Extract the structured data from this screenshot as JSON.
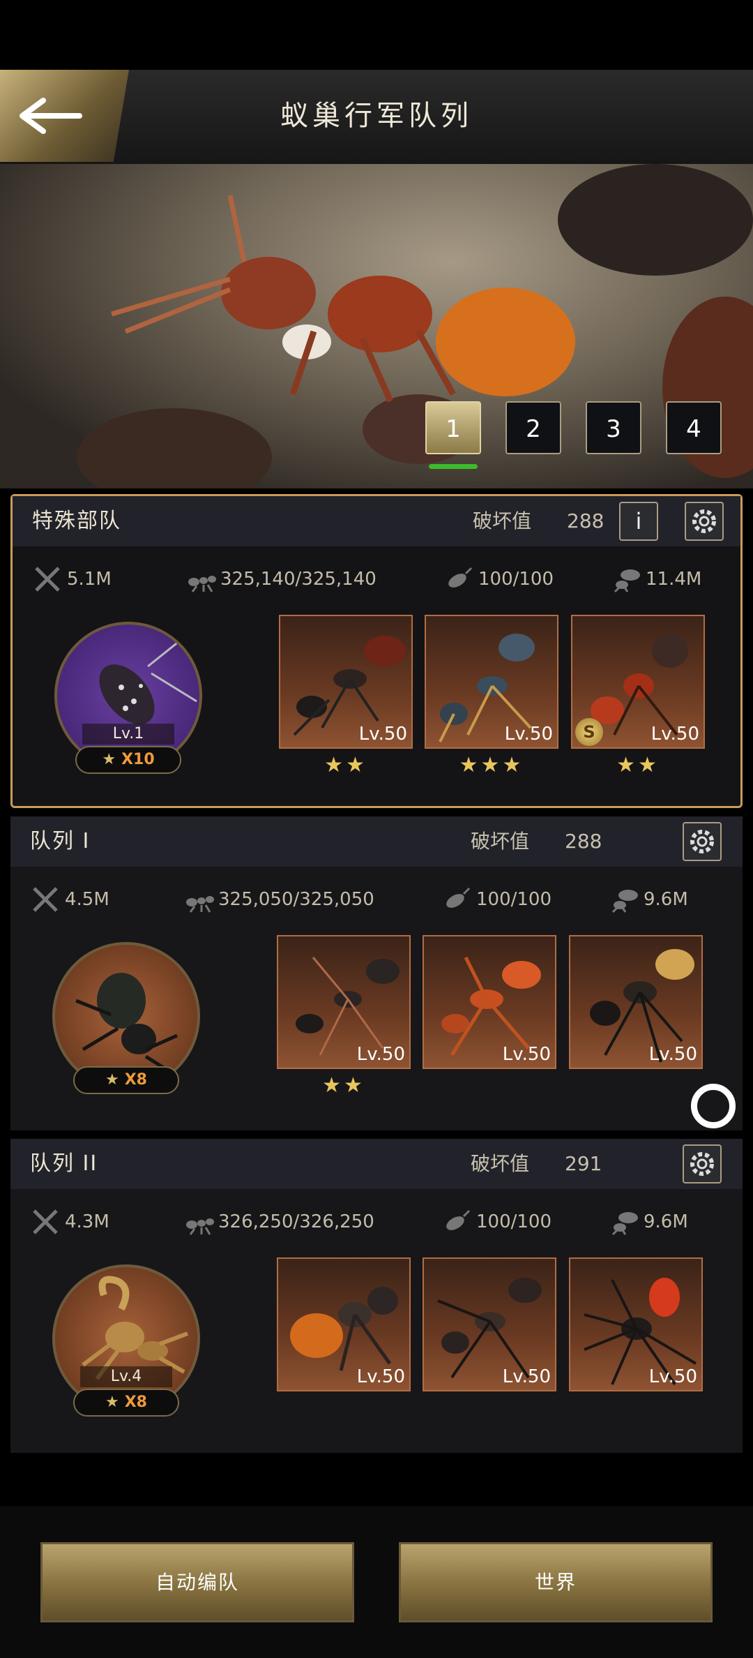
{
  "header": {
    "title": "蚁巢行军队列"
  },
  "page_tabs": [
    "1",
    "2",
    "3",
    "4"
  ],
  "squads": [
    {
      "name": "特殊部队",
      "power_label": "破坏值",
      "power": "288",
      "stats": {
        "attack": "5.1M",
        "troops": "325,140/325,140",
        "morale": "100/100",
        "load": "11.4M"
      },
      "hero": {
        "level": "Lv.1",
        "stars": "X10"
      },
      "units": [
        {
          "level": "Lv.50",
          "stars": "★★"
        },
        {
          "level": "Lv.50",
          "stars": "★★★"
        },
        {
          "level": "Lv.50",
          "stars": "★★",
          "badge": "S"
        }
      ]
    },
    {
      "name": "队列 I",
      "power_label": "破坏值",
      "power": "288",
      "stats": {
        "attack": "4.5M",
        "troops": "325,050/325,050",
        "morale": "100/100",
        "load": "9.6M"
      },
      "hero": {
        "level": "",
        "stars": "X8"
      },
      "units": [
        {
          "level": "Lv.50",
          "stars": "★★"
        },
        {
          "level": "Lv.50",
          "stars": ""
        },
        {
          "level": "Lv.50",
          "stars": ""
        }
      ]
    },
    {
      "name": "队列 II",
      "power_label": "破坏值",
      "power": "291",
      "stats": {
        "attack": "4.3M",
        "troops": "326,250/326,250",
        "morale": "100/100",
        "load": "9.6M"
      },
      "hero": {
        "level": "Lv.4",
        "stars": "X8"
      },
      "units": [
        {
          "level": "Lv.50",
          "stars": ""
        },
        {
          "level": "Lv.50",
          "stars": ""
        },
        {
          "level": "Lv.50",
          "stars": ""
        }
      ]
    }
  ],
  "buttons": {
    "auto_formation": "自动编队",
    "world": "世界"
  },
  "icons": {
    "back": "back-arrow-icon",
    "info": "info-icon",
    "settings": "gear-icon"
  },
  "colors": {
    "accent": "#c99b58",
    "tab_active": "#3dbb2c"
  }
}
